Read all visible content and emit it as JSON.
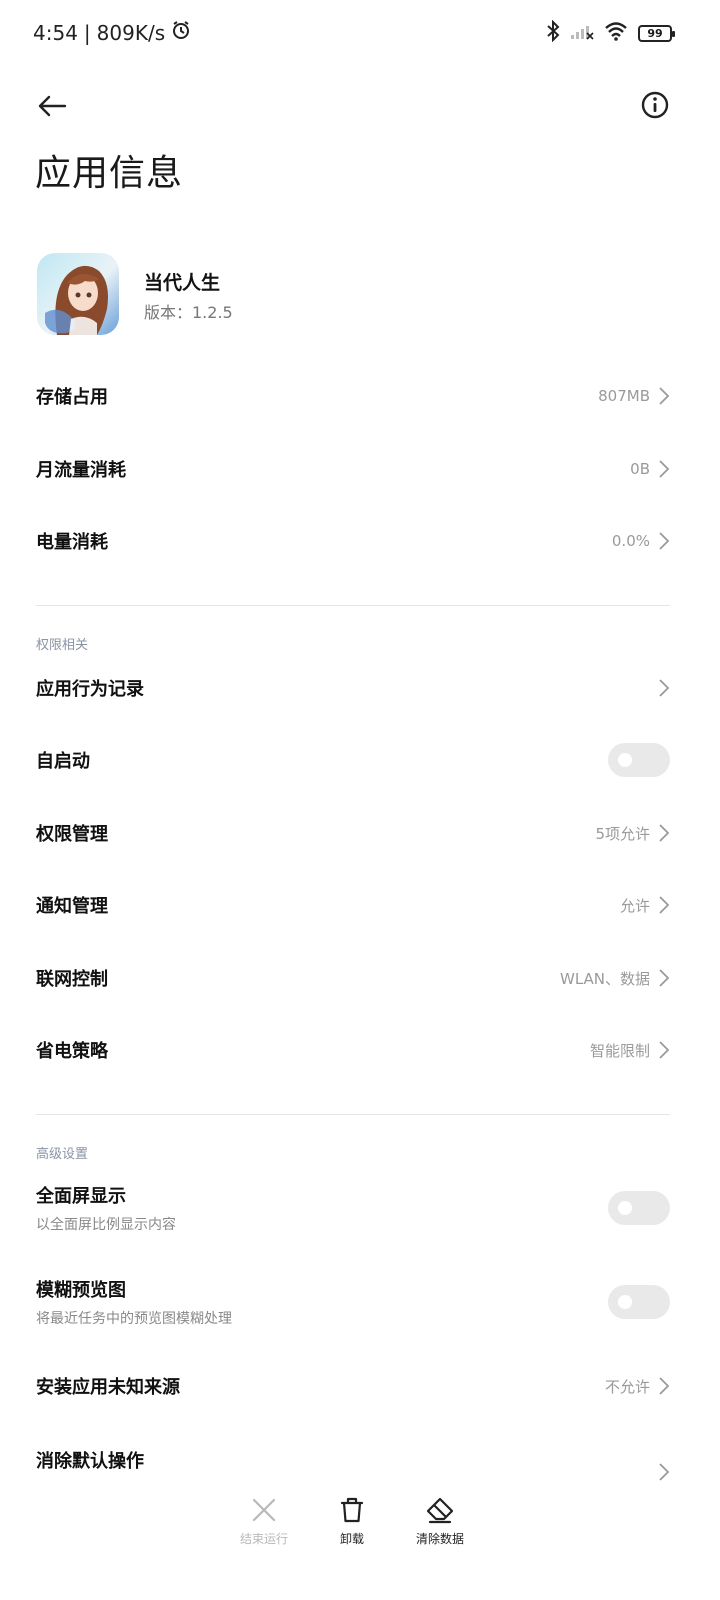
{
  "status_bar": {
    "time": "4:54",
    "separator": "|",
    "net_speed": "809K/s",
    "battery": "99"
  },
  "title": "应用信息",
  "app": {
    "name": "当代人生",
    "version": "版本：1.2.5"
  },
  "usage": [
    {
      "label": "存储占用",
      "value": "807MB"
    },
    {
      "label": "月流量消耗",
      "value": "0B"
    },
    {
      "label": "电量消耗",
      "value": "0.0%"
    }
  ],
  "permissions_section": {
    "header": "权限相关",
    "behavior_log": "应用行为记录",
    "autostart": {
      "label": "自启动",
      "enabled": false
    },
    "items": [
      {
        "label": "权限管理",
        "value": "5项允许"
      },
      {
        "label": "通知管理",
        "value": "允许"
      },
      {
        "label": "联网控制",
        "value": "WLAN、数据"
      },
      {
        "label": "省电策略",
        "value": "智能限制"
      }
    ]
  },
  "advanced_section": {
    "header": "高级设置",
    "fullscreen": {
      "label": "全面屏显示",
      "sub": "以全面屏比例显示内容",
      "enabled": false
    },
    "blur_preview": {
      "label": "模糊预览图",
      "sub": "将最近任务中的预览图模糊处理",
      "enabled": false
    },
    "unknown_sources": {
      "label": "安装应用未知来源",
      "value": "不允许"
    },
    "clear_defaults": {
      "label": "消除默认操作"
    }
  },
  "bottom_actions": {
    "force_stop": "结束运行",
    "uninstall": "卸载",
    "clear_data": "清除数据"
  }
}
